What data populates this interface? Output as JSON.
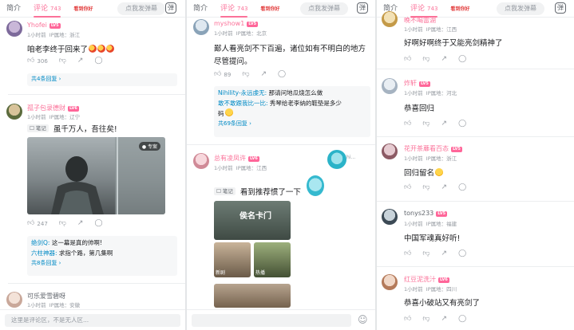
{
  "colors": {
    "accent": "#fb7299",
    "link": "#008ac5",
    "text": "#18191c",
    "muted": "#9499a0"
  },
  "tabs": {
    "intro": "简介",
    "comments": "评论",
    "count": "743"
  },
  "promo": "看到你好",
  "danmu_placeholder": "点我发弹幕",
  "danmu_icon": "danmu-toggle-icon",
  "p1": {
    "c1": {
      "name": "Yhofei",
      "level": "LV5",
      "time": "1小时前",
      "ip": "IP属地：浙江",
      "text": "咱老李终于回来了",
      "likes": "306",
      "more": "共4条回复 ›"
    },
    "c2": {
      "name": "孤子包录德财",
      "level": "LV6",
      "time": "1小时前",
      "ip": "IP属地：辽宁",
      "note": "笔记",
      "text": "虽千万人，吾往矣!",
      "badge": "专案",
      "likes": "247",
      "replies": [
        {
          "name": "绝剑Q:",
          "text": "这一幕是真的帅啊!"
        },
        {
          "name": "六柱神器:",
          "text": "求指个路，第几集啊"
        }
      ],
      "more": "共8条回复 ›"
    },
    "c3": {
      "name": "可乐爱雪碧呀",
      "time": "1小时前",
      "ip": "IP属地：安徽"
    },
    "input_placeholder": "这里是评论区，不是无人区..."
  },
  "p2": {
    "c1": {
      "name": "myshow1",
      "level": "LV5",
      "time": "1小时前",
      "ip": "IP属地：北京",
      "text1": "鄙人看亮剑不下百遍，诸位如有不明白的地方",
      "text2": "尽管提问。",
      "likes": "89",
      "replies": [
        {
          "name": "Nihility-永远虔无:",
          "text": "那请问地瓜烧怎么做"
        },
        {
          "name": "敢不敢跟我比一比:",
          "text": "秀琴给老李纳的鞋垫是多少"
        },
        {
          "name": "",
          "text": "码"
        }
      ],
      "more": "共69条回复 ›"
    },
    "c2": {
      "name": "总有凌凤许",
      "level": "LV6",
      "time": "1小时前",
      "ip": "IP属地：江西",
      "note": "笔记",
      "text": "看到推荐惯了一下",
      "sticker": "hi..."
    },
    "thumbs": [
      {
        "title": "侯名卡门"
      },
      {
        "title": "新剧"
      },
      {
        "title": "热播"
      }
    ]
  },
  "p3": {
    "c0": {
      "name": "晚不喝雷湖",
      "time": "1小时前",
      "ip": "IP属地：江西",
      "text": "好啊好啊终于又能亮剑精神了"
    },
    "c1": {
      "name": "炸轩",
      "level": "LV5",
      "time": "1小时前",
      "ip": "IP属地：河北",
      "text": "恭喜回归"
    },
    "c2": {
      "name": "花开茶蘼看百态",
      "level": "LV5",
      "time": "1小时前",
      "ip": "IP属地：浙江",
      "text": "回归留名"
    },
    "c3": {
      "name": "tonys233",
      "level": "LV5",
      "time": "1小时前",
      "ip": "IP属地：福建",
      "text": "中国军魂真好听!"
    },
    "c4": {
      "name": "红豆泥洗汁",
      "level": "LV6",
      "time": "1小时前",
      "ip": "IP属地：四川",
      "text": "恭喜小破站又有亮剑了"
    }
  },
  "icons": [
    "like-icon",
    "dislike-icon",
    "share-icon",
    "comment-icon",
    "emoji-icon"
  ]
}
